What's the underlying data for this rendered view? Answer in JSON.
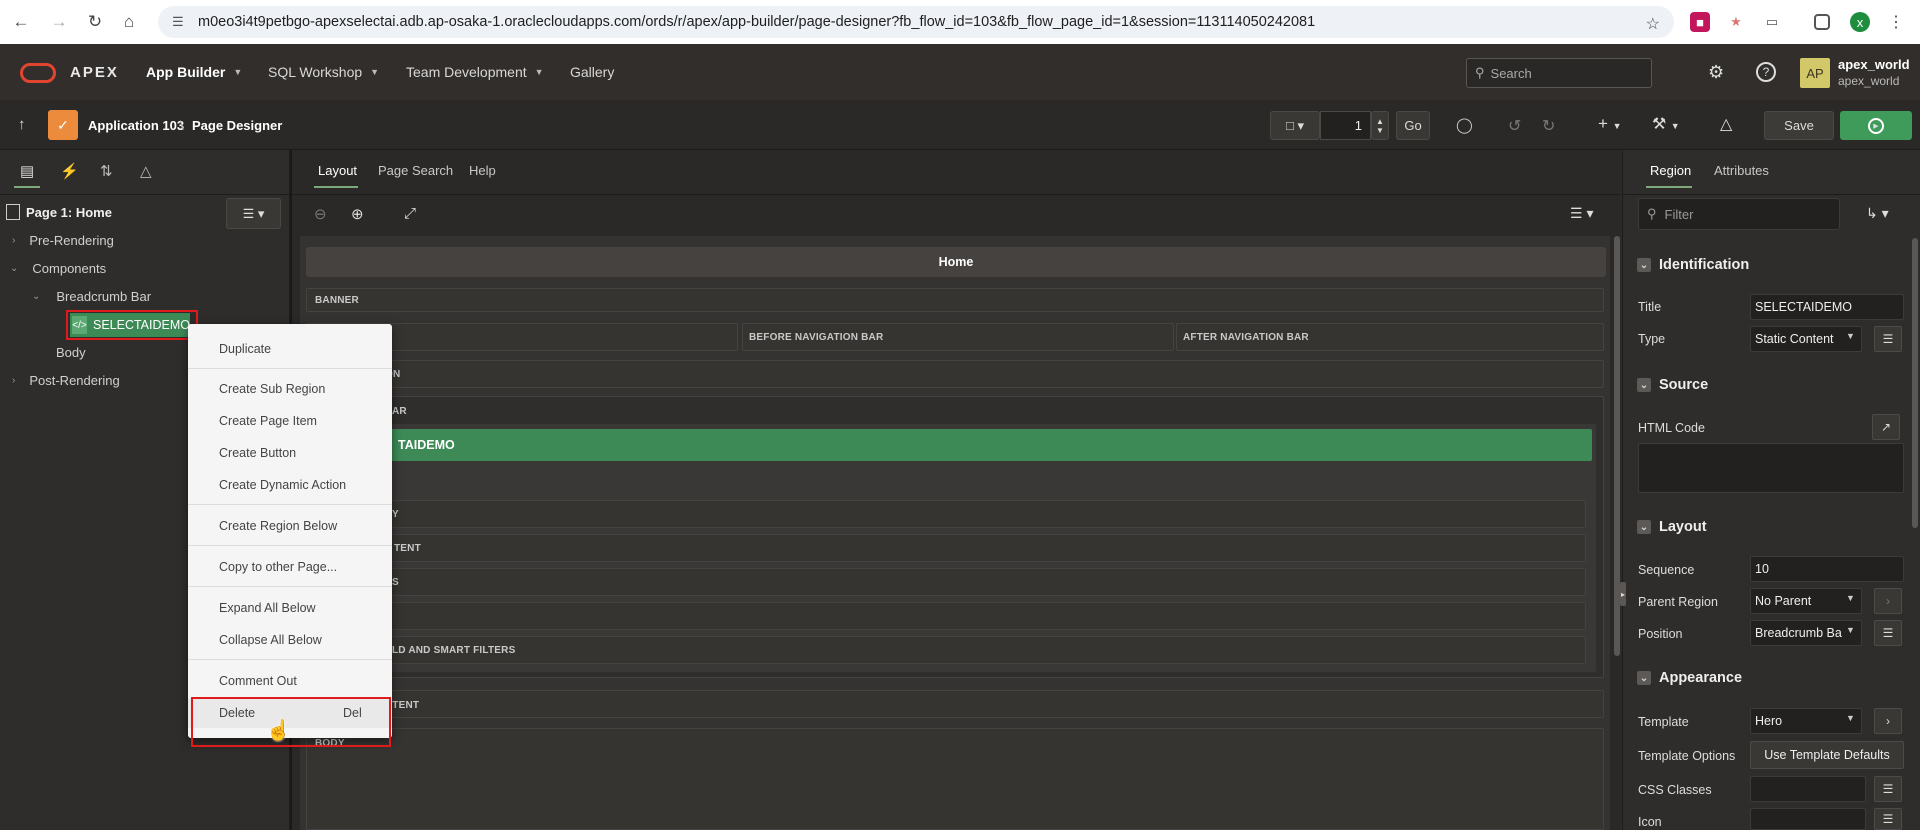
{
  "browser": {
    "url": "m0eo3i4t9petbgo-apexselectai.adb.ap-osaka-1.oraclecloudapps.com/ords/r/apex/app-builder/page-designer?fb_flow_id=103&fb_flow_page_id=1&session=113114050242081",
    "profile_initial": "x"
  },
  "header": {
    "brand": "APEX",
    "menu": [
      {
        "label": "App Builder"
      },
      {
        "label": "SQL Workshop"
      },
      {
        "label": "Team Development"
      },
      {
        "label": "Gallery"
      }
    ],
    "search_placeholder": "Search",
    "user_initials": "AP",
    "user_name": "apex_world",
    "user_workspace": "apex_world"
  },
  "toolbar": {
    "app_label": "Application 103",
    "separator": "\\",
    "page_designer_label": "Page Designer",
    "page_number": "1",
    "go_label": "Go",
    "save_label": "Save"
  },
  "left_pane": {
    "page_title": "Page 1: Home",
    "tree": {
      "pre_rendering": "Pre-Rendering",
      "components": "Components",
      "breadcrumb_bar": "Breadcrumb Bar",
      "selected_region": "SELECTAIDEMO",
      "body": "Body",
      "post_rendering": "Post-Rendering"
    }
  },
  "context_menu": {
    "duplicate": "Duplicate",
    "create_sub_region": "Create Sub Region",
    "create_page_item": "Create Page Item",
    "create_button": "Create Button",
    "create_dynamic_action": "Create Dynamic Action",
    "create_region_below": "Create Region Below",
    "copy_to_other_page": "Copy to other Page...",
    "expand_all_below": "Expand All Below",
    "collapse_all_below": "Collapse All Below",
    "comment_out": "Comment Out",
    "delete": "Delete",
    "delete_shortcut": "Del"
  },
  "center": {
    "tabs": [
      {
        "label": "Layout"
      },
      {
        "label": "Page Search"
      },
      {
        "label": "Help"
      }
    ],
    "page_header": "Home",
    "slots": {
      "banner": "BANNER",
      "before_nav": "BEFORE NAVIGATION BAR",
      "after_nav": "AFTER NAVIGATION BAR",
      "navigation_partial": "ON",
      "breadcrumb_partial": "AR",
      "region_partial": "TAIDEMO",
      "sub1": "Y",
      "sub2": "TENT",
      "sub3": "S",
      "sub4": "",
      "sub5": "LD AND SMART FILTERS",
      "content_partial": "ENTENT",
      "body": "BODY"
    }
  },
  "right_pane": {
    "tabs": [
      {
        "label": "Region"
      },
      {
        "label": "Attributes"
      }
    ],
    "filter_placeholder": "Filter",
    "sections": {
      "identification": "Identification",
      "source": "Source",
      "layout": "Layout",
      "appearance": "Appearance"
    },
    "props": {
      "title_label": "Title",
      "title_value": "SELECTAIDEMO",
      "type_label": "Type",
      "type_value": "Static Content",
      "html_code_label": "HTML Code",
      "sequence_label": "Sequence",
      "sequence_value": "10",
      "parent_region_label": "Parent Region",
      "parent_region_value": "No Parent",
      "position_label": "Position",
      "position_value": "Breadcrumb Ba",
      "template_label": "Template",
      "template_value": "Hero",
      "template_options_label": "Template Options",
      "template_options_button": "Use Template Defaults",
      "css_classes_label": "CSS Classes",
      "icon_label": "Icon"
    }
  },
  "colors": {
    "region_green": "#3d8a57",
    "accent_red": "#e01b1b",
    "save_green": "#3e9b5a"
  }
}
